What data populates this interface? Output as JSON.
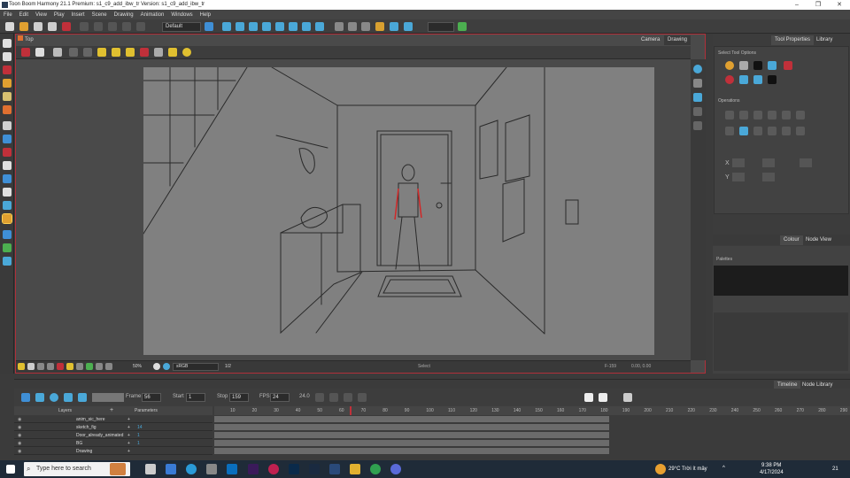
{
  "window": {
    "title": "Toon Boom Harmony 21.1 Premium: s1_c9_add_ibw_tr Version: s1_c9_add_ibw_tr",
    "minimize": "–",
    "maximize": "❐",
    "close": "✕"
  },
  "menu": [
    "File",
    "Edit",
    "View",
    "Play",
    "Insert",
    "Scene",
    "Drawing",
    "Animation",
    "Windows",
    "Help"
  ],
  "toolbar": {
    "workspace_value": "Default"
  },
  "view": {
    "tab_label": "Top",
    "camera_tab": "Camera",
    "drawing_tab": "Drawing",
    "zoom": "50%",
    "colorspace": "sRGB",
    "frame_field": "1/2",
    "mode": "Select",
    "status_right": "F-159",
    "coords": "0.00, 0.00"
  },
  "side_panel": {
    "tab_tool_properties": "Tool Properties",
    "tab_library": "Library",
    "select_tool_options": "Select Tool Options",
    "operations": "Operations",
    "x_label": "X",
    "y_label": "Y",
    "tab_colour": "Colour",
    "tab_node_view": "Node View",
    "palettes": "Palettes"
  },
  "timeline": {
    "tab_timeline": "Timeline",
    "tab_node_library": "Node Library",
    "frame_label": "Frame",
    "frame_value": "56",
    "start_label": "Start",
    "start_value": "1",
    "stop_label": "Stop",
    "stop_value": "159",
    "fps_label": "FPS",
    "fps_value": "24",
    "fps_secondary": "24.0",
    "layers_header": "Layers",
    "parameters_header": "Parameters",
    "layers": [
      {
        "name": "anim_sic_here",
        "param": ""
      },
      {
        "name": "sketch_fig",
        "param": "14"
      },
      {
        "name": "Door_already_animated",
        "param": "1"
      },
      {
        "name": "BG",
        "param": "1"
      },
      {
        "name": "Drawing",
        "param": ""
      }
    ],
    "ruler_marks": [
      "10",
      "20",
      "30",
      "40",
      "50",
      "60",
      "70",
      "80",
      "90",
      "100",
      "110",
      "120",
      "130",
      "140",
      "150",
      "160",
      "170",
      "180",
      "190",
      "200",
      "210",
      "220",
      "230",
      "240",
      "250",
      "260",
      "270",
      "280",
      "290"
    ]
  },
  "taskbar": {
    "search_placeholder": "Type here to search",
    "weather": "29°C  Trời ít mây",
    "time": "9:38 PM",
    "date": "4/17/2024",
    "notification_count": "21"
  },
  "colors": {
    "accent_red": "#c0303a",
    "panel_bg": "#3c3c3c",
    "canvas_gray": "#808080",
    "sketch_line": "#2a2a2a",
    "arm_red": "#d02828"
  }
}
